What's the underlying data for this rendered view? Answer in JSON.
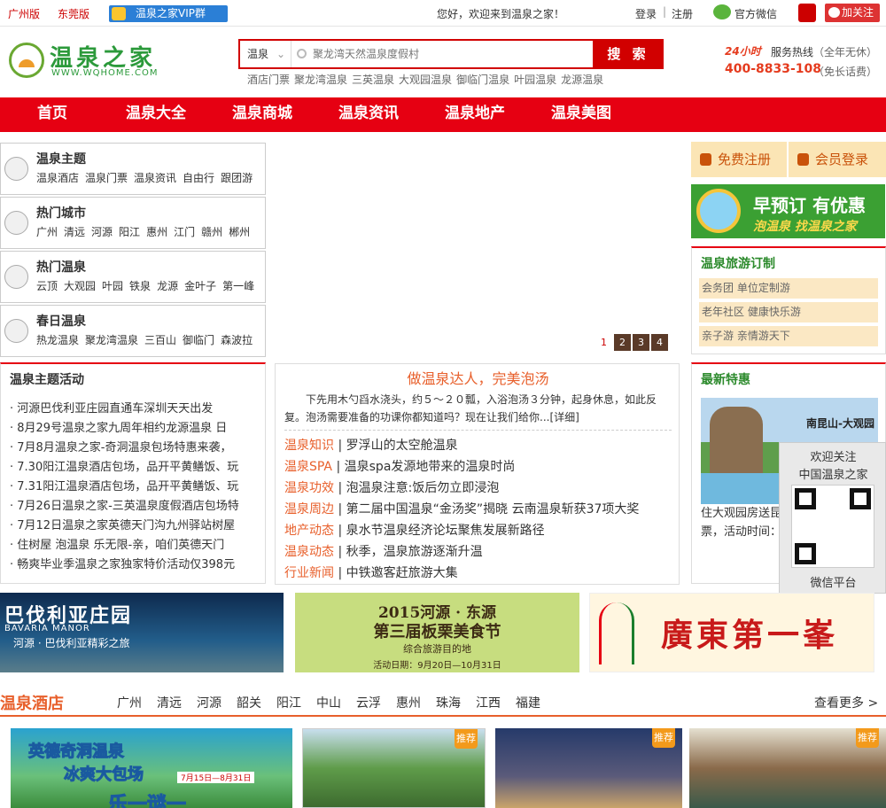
{
  "topbar": {
    "cities": [
      "广州版",
      "东莞版"
    ],
    "vip_group": "温泉之家VIP群",
    "welcome": "您好，欢迎来到温泉之家！",
    "login": "登录",
    "separator": "|",
    "register": "注册",
    "wechat": "官方微信",
    "weibo_follow": "加关注"
  },
  "header": {
    "logo_name": "温泉之家",
    "logo_url": "WWW.WQHOME.COM",
    "search": {
      "type": "温泉",
      "placeholder": "聚龙湾天然温泉度假村",
      "button": "搜 索"
    },
    "hotwords": [
      "酒店门票",
      "聚龙湾温泉",
      "三英温泉",
      "大观园温泉",
      "御临门温泉",
      "叶园温泉",
      "龙源温泉"
    ],
    "hotline": {
      "badge": "24小时",
      "label": "服务热线",
      "note1": "（全年无休）",
      "number": "400-8833-108",
      "note2": "（免长话费）"
    }
  },
  "nav": [
    "首页",
    "温泉大全",
    "温泉商城",
    "温泉资讯",
    "温泉地产",
    "温泉美图"
  ],
  "categories": [
    {
      "title": "温泉主题",
      "icon": "star-icon",
      "links": [
        "温泉酒店",
        "温泉门票",
        "温泉资讯",
        "自由行",
        "跟团游"
      ]
    },
    {
      "title": "热门城市",
      "icon": "city-icon",
      "links": [
        "广州",
        "清远",
        "河源",
        "阳江",
        "惠州",
        "江门",
        "赣州",
        "郴州"
      ]
    },
    {
      "title": "热门温泉",
      "icon": "spring-icon",
      "links": [
        "云顶",
        "大观园",
        "叶园",
        "铁泉",
        "龙源",
        "金叶子",
        "第一峰"
      ]
    },
    {
      "title": "春日温泉",
      "icon": "bath-icon",
      "links": [
        "热龙温泉",
        "聚龙湾温泉",
        "三百山",
        "御临门",
        "森波拉"
      ]
    }
  ],
  "slider": {
    "pages": [
      "1",
      "2",
      "3",
      "4"
    ],
    "active": "1"
  },
  "account": {
    "register": "免费注册",
    "login": "会员登录"
  },
  "promo": {
    "title": "早预订 有优惠",
    "subtitle": "泡温泉 找温泉之家"
  },
  "travel": {
    "title": "温泉旅游订制",
    "rows": [
      "会务团  单位定制游",
      "老年社区  健康快乐游",
      "亲子游  亲情游天下"
    ]
  },
  "activity": {
    "title": "温泉主题活动",
    "items": [
      "河源巴伐利亚庄园直通车深圳天天出发",
      "8月29号温泉之家九周年相约龙源温泉 日",
      "7月8月温泉之家-奇洞温泉包场特惠来袭，",
      "7.30阳江温泉酒店包场，品开平黄鳝饭、玩",
      "7.31阳江温泉酒店包场，品开平黄鳝饭、玩",
      "7月26日温泉之家-三英温泉度假酒店包场特",
      "7月12日温泉之家英德天门沟九州驿站树屋",
      "住树屋 泡温泉 乐无限-亲，咱们英德天门",
      "畅爽毕业季温泉之家独家特价活动仅398元"
    ]
  },
  "article": {
    "title": "做温泉达人，完美泡汤",
    "intro": "下先用木勺舀水浇头，约５～２０瓢，入浴泡汤３分钟，起身休息，如此反复。泡汤需要准备的功课你都知道吗？现在让我们给你...[详细]",
    "news": [
      {
        "cat": "温泉知识",
        "text": "罗浮山的太空舱温泉"
      },
      {
        "cat": "温泉SPA",
        "text": "温泉spa发源地带来的温泉时尚"
      },
      {
        "cat": "温泉功效",
        "text": "泡温泉注意:饭后勿立即浸泡"
      },
      {
        "cat": "温泉周边",
        "text": "第二届中国温泉“金汤奖”揭晓 云南温泉斩获37项大奖"
      },
      {
        "cat": "地产动态",
        "text": "泉水节温泉经济论坛聚焦发展新路径"
      },
      {
        "cat": "温泉动态",
        "text": "秋季，温泉旅游逐渐升温"
      },
      {
        "cat": "行业新闻",
        "text": "中铁邀客赶旅游大集"
      }
    ]
  },
  "deals": {
    "title": "最新特惠",
    "image_tag": "南昆山-大观园",
    "desc": "住大观园房送昆 128元/张），每 票，活动时间： 日。"
  },
  "qr": {
    "line1": "欢迎关注",
    "line2": "中国温泉之家",
    "line3": "微信平台"
  },
  "banners": {
    "b1_title": "巴伐利亚庄园",
    "b1_en": "BAVARIA MANOR",
    "b1_sub": "河源 · 巴伐利亚精彩之旅",
    "b2_line1": "2015河源 · 东源",
    "b2_line2": "第三届板栗美食节",
    "b2_line3": "综合旅游目的地",
    "b2_line4": "活动日期：9月20日—10月31日",
    "b3_title": "廣東第一峯"
  },
  "hotel": {
    "title": "温泉酒店",
    "tabs": [
      "广州",
      "清远",
      "河源",
      "韶关",
      "阳江",
      "中山",
      "云浮",
      "惠州",
      "珠海",
      "江西",
      "福建"
    ],
    "more": "查看更多  >",
    "pic1_line1": "英德奇洞温泉",
    "pic1_line2": "冰爽大包场",
    "pic1_date": "7月15日—8月31日",
    "pic1_line3": "乐一谜一",
    "recommend": "推荐"
  },
  "colors": {
    "brand_red": "#e60012",
    "accent_orange": "#e8602c",
    "brand_green": "#2c9a3b"
  }
}
